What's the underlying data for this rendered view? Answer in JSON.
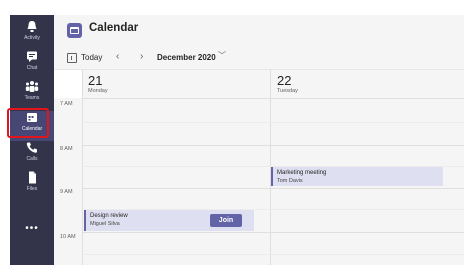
{
  "rail": {
    "items": [
      {
        "label": "Activity",
        "icon": "bell-icon"
      },
      {
        "label": "Chat",
        "icon": "chat-icon"
      },
      {
        "label": "Teams",
        "icon": "teams-icon"
      },
      {
        "label": "Calendar",
        "icon": "calendar-icon",
        "active": true
      },
      {
        "label": "Calls",
        "icon": "phone-icon"
      },
      {
        "label": "Files",
        "icon": "file-icon"
      }
    ],
    "more": "•••"
  },
  "header": {
    "title": "Calendar"
  },
  "toolbar": {
    "today_label": "Today",
    "prev": "‹",
    "next": "›",
    "month_label": "December 2020",
    "month_chevron": "﹀"
  },
  "days": [
    {
      "number": "21",
      "name": "Monday"
    },
    {
      "number": "22",
      "name": "Tuesday"
    }
  ],
  "times": [
    "7 AM",
    "8 AM",
    "9 AM",
    "10 AM"
  ],
  "events": [
    {
      "title": "Marketing meeting",
      "organizer": "Tom Davis"
    },
    {
      "title": "Design review",
      "organizer": "Miguel Silva",
      "action": "Join"
    }
  ],
  "colors": {
    "rail": "#33344a",
    "accent": "#6264a7",
    "event_bg": "#dedff0",
    "highlight": "#e3141c"
  }
}
